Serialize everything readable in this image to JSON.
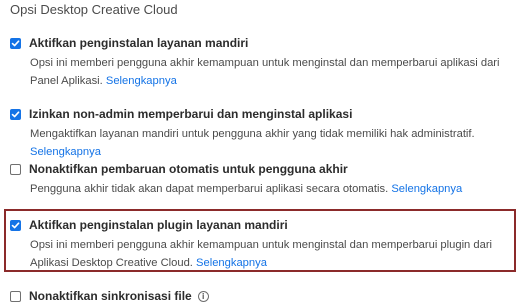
{
  "section_title": "Opsi Desktop Creative Cloud",
  "options": [
    {
      "label": "Aktifkan penginstalan layanan mandiri",
      "checked": true,
      "description": "Opsi ini memberi pengguna akhir kemampuan untuk menginstal dan memperbarui aplikasi dari Panel Aplikasi.",
      "link": "Selengkapnya"
    },
    {
      "label": "Izinkan non-admin memperbarui dan menginstal aplikasi",
      "checked": true,
      "description": "Mengaktifkan layanan mandiri untuk pengguna akhir yang tidak memiliki hak administratif.",
      "link": "Selengkapnya"
    },
    {
      "label": "Nonaktifkan pembaruan otomatis untuk pengguna akhir",
      "checked": false,
      "description": "Pengguna akhir tidak akan dapat memperbarui aplikasi secara otomatis.",
      "link": "Selengkapnya"
    },
    {
      "label": "Aktifkan penginstalan plugin layanan mandiri",
      "checked": true,
      "highlighted": true,
      "description": "Opsi ini memberi pengguna akhir kemampuan untuk menginstal dan memperbarui plugin dari Aplikasi Desktop Creative Cloud.",
      "link": "Selengkapnya"
    },
    {
      "label": "Nonaktifkan sinkronisasi file",
      "checked": false,
      "icon": "info-icon"
    }
  ],
  "colors": {
    "accent": "#1473e6",
    "highlight_border": "#8b2a2a"
  }
}
